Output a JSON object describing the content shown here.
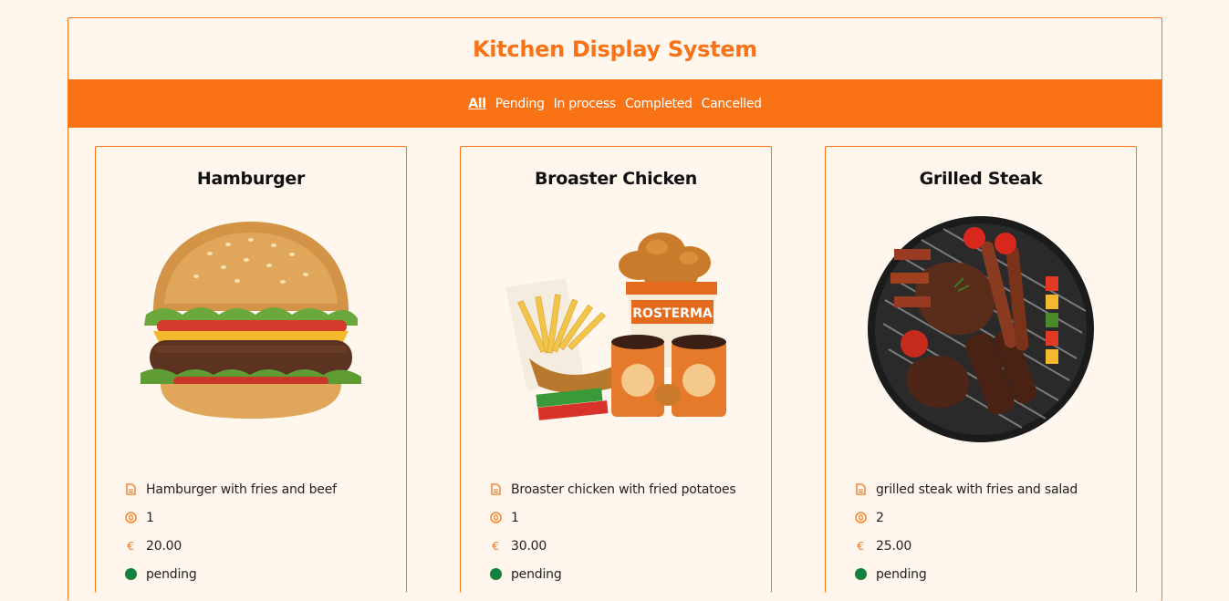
{
  "header": {
    "title": "Kitchen Display System"
  },
  "nav": {
    "items": [
      {
        "label": "All"
      },
      {
        "label": "Pending"
      },
      {
        "label": "In process"
      },
      {
        "label": "Completed"
      },
      {
        "label": "Cancelled"
      }
    ],
    "active": "All"
  },
  "orders": [
    {
      "name": "Hamburger",
      "description": "Hamburger with fries and beef",
      "quantity": "1",
      "price": "20.00",
      "status": "pending",
      "image_icon": "hamburger-image"
    },
    {
      "name": "Broaster Chicken",
      "description": "Broaster chicken with fried potatoes",
      "quantity": "1",
      "price": "30.00",
      "status": "pending",
      "image_icon": "broaster-chicken-image"
    },
    {
      "name": "Grilled Steak",
      "description": "grilled steak with fries and salad",
      "quantity": "2",
      "price": "25.00",
      "status": "pending",
      "image_icon": "grilled-steak-image"
    }
  ],
  "icons": {
    "description": "document-icon",
    "quantity": "coin-icon",
    "price": "euro-icon",
    "status": "status-dot-icon"
  },
  "icon_glyphs": {
    "euro": "€"
  },
  "colors": {
    "accent": "#f97316",
    "background": "#fff7ed",
    "status_pending": "#15803d"
  }
}
